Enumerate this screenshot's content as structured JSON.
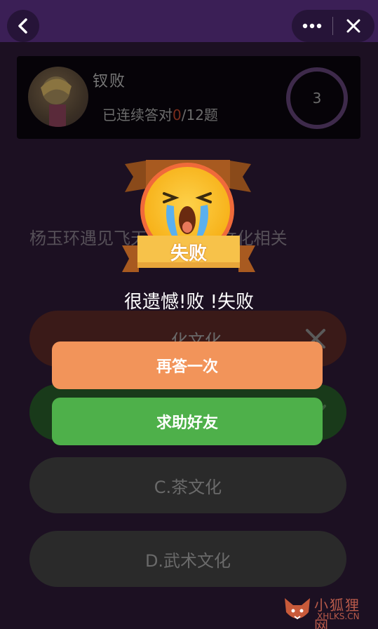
{
  "nav": {
    "back_icon": "chevron-left-icon",
    "more_icon": "more-dots-icon",
    "close_icon": "close-icon"
  },
  "player": {
    "name": "钗败",
    "streak_prefix": "已连续答对",
    "streak_count": "0",
    "streak_suffix": "/12题",
    "timer": "3"
  },
  "question": {
    "text": "杨玉环遇见飞天 以下哪种文化相关"
  },
  "options": [
    {
      "label": "…化文化",
      "state": "wrong"
    },
    {
      "label": "",
      "state": "correct"
    },
    {
      "label": "C.茶文化",
      "state": "neutral"
    },
    {
      "label": "D.武术文化",
      "state": "neutral"
    }
  ],
  "popup": {
    "badge_label": "失败",
    "message": "很遗憾!败 !失败",
    "retry_label": "再答一次",
    "help_label": "求助好友"
  },
  "watermark": {
    "name": "小狐狸网",
    "url": "XHLKS.CN"
  },
  "colors": {
    "nav": "#3b1f56",
    "retry": "#f2945a",
    "help": "#4eb04a",
    "badge": "#f7c24a"
  }
}
